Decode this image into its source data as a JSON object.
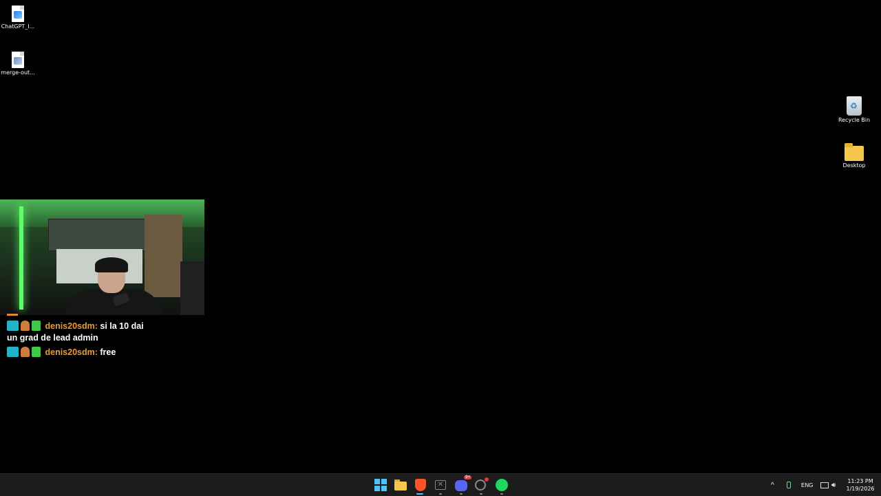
{
  "desktop": {
    "icons_left": [
      {
        "label": "ChatGPT_I...",
        "icon": "image-file-icon"
      },
      {
        "label": "merge-out...",
        "icon": "audio-file-icon"
      }
    ],
    "icons_right": [
      {
        "label": "Recycle Bin",
        "icon": "recycle-bin-icon"
      },
      {
        "label": "Desktop",
        "icon": "folder-icon"
      }
    ]
  },
  "chat": {
    "messages": [
      {
        "user": "denis20sdm:",
        "text": "si la 10 dai",
        "continuation": "un grad de lead admin"
      },
      {
        "user": "denis20sdm:",
        "text": "free"
      }
    ],
    "username_color": "#e89b3a"
  },
  "taskbar": {
    "apps": [
      "start-icon",
      "file-explorer-icon",
      "brave-icon",
      "xbox-icon",
      "discord-icon",
      "chrome-icon",
      "spotify-icon"
    ],
    "discord_badge": "9+",
    "tray": {
      "chevron": "^",
      "language": "ENG",
      "time": "11:23 PM",
      "date": "1/19/2026"
    }
  }
}
